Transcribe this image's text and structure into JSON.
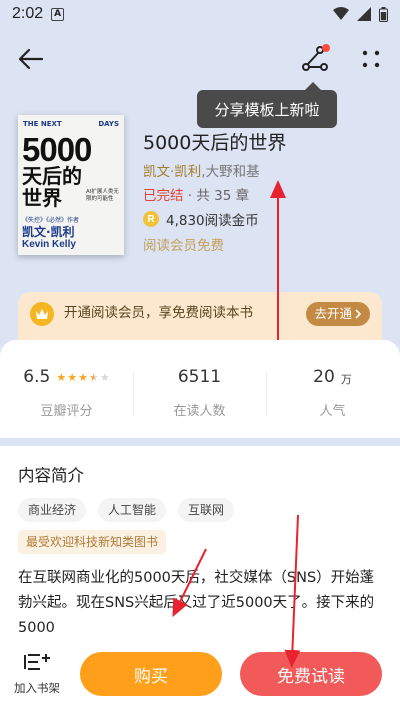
{
  "status_bar": {
    "time": "2:02",
    "badge": "A"
  },
  "tooltip": {
    "text": "分享模板上新啦"
  },
  "cover": {
    "top_left": "THE NEXT",
    "top_right": "DAYS",
    "number": "5000",
    "title": "天后的世界",
    "side_text": "AI扩展人类无限的可能性",
    "series": "《失控》《必然》作者",
    "author_cn": "凯文·凯利",
    "author_en": "Kevin Kelly"
  },
  "book": {
    "title": "5000天后的世界",
    "author_main": "凯文·凯利",
    "author_rest": ",大野和基",
    "status": "已完结",
    "chapters": " · 共 35 章",
    "coin_symbol": "R",
    "coins": "4,830阅读金币",
    "member_note": "阅读会员免费"
  },
  "vip": {
    "text": "开通阅读会员，享免费阅读本书",
    "button": "去开通"
  },
  "stats": {
    "rating": {
      "value": "6.5",
      "label": "豆瓣评分",
      "stars": 3.5
    },
    "readers": {
      "value": "6511",
      "label": "在读人数"
    },
    "popularity": {
      "value": "20",
      "unit": "万",
      "label": "人气"
    }
  },
  "intro": {
    "title": "内容简介",
    "tags": [
      "商业经济",
      "人工智能",
      "互联网"
    ],
    "rank": "最受欢迎科技新知类图书",
    "text": "在互联网商业化的5000天后，社交媒体（SNS）开始蓬勃兴起。现在SNS兴起后又过了近5000天了。接下来的5000"
  },
  "bottom": {
    "shelf": "加入书架",
    "buy": "购买",
    "trial": "免费试读"
  },
  "colors": {
    "accent": "#ff9f1a",
    "danger": "#f25a5a",
    "arrow": "#e8232f",
    "header_bg": "#dce3f2"
  }
}
